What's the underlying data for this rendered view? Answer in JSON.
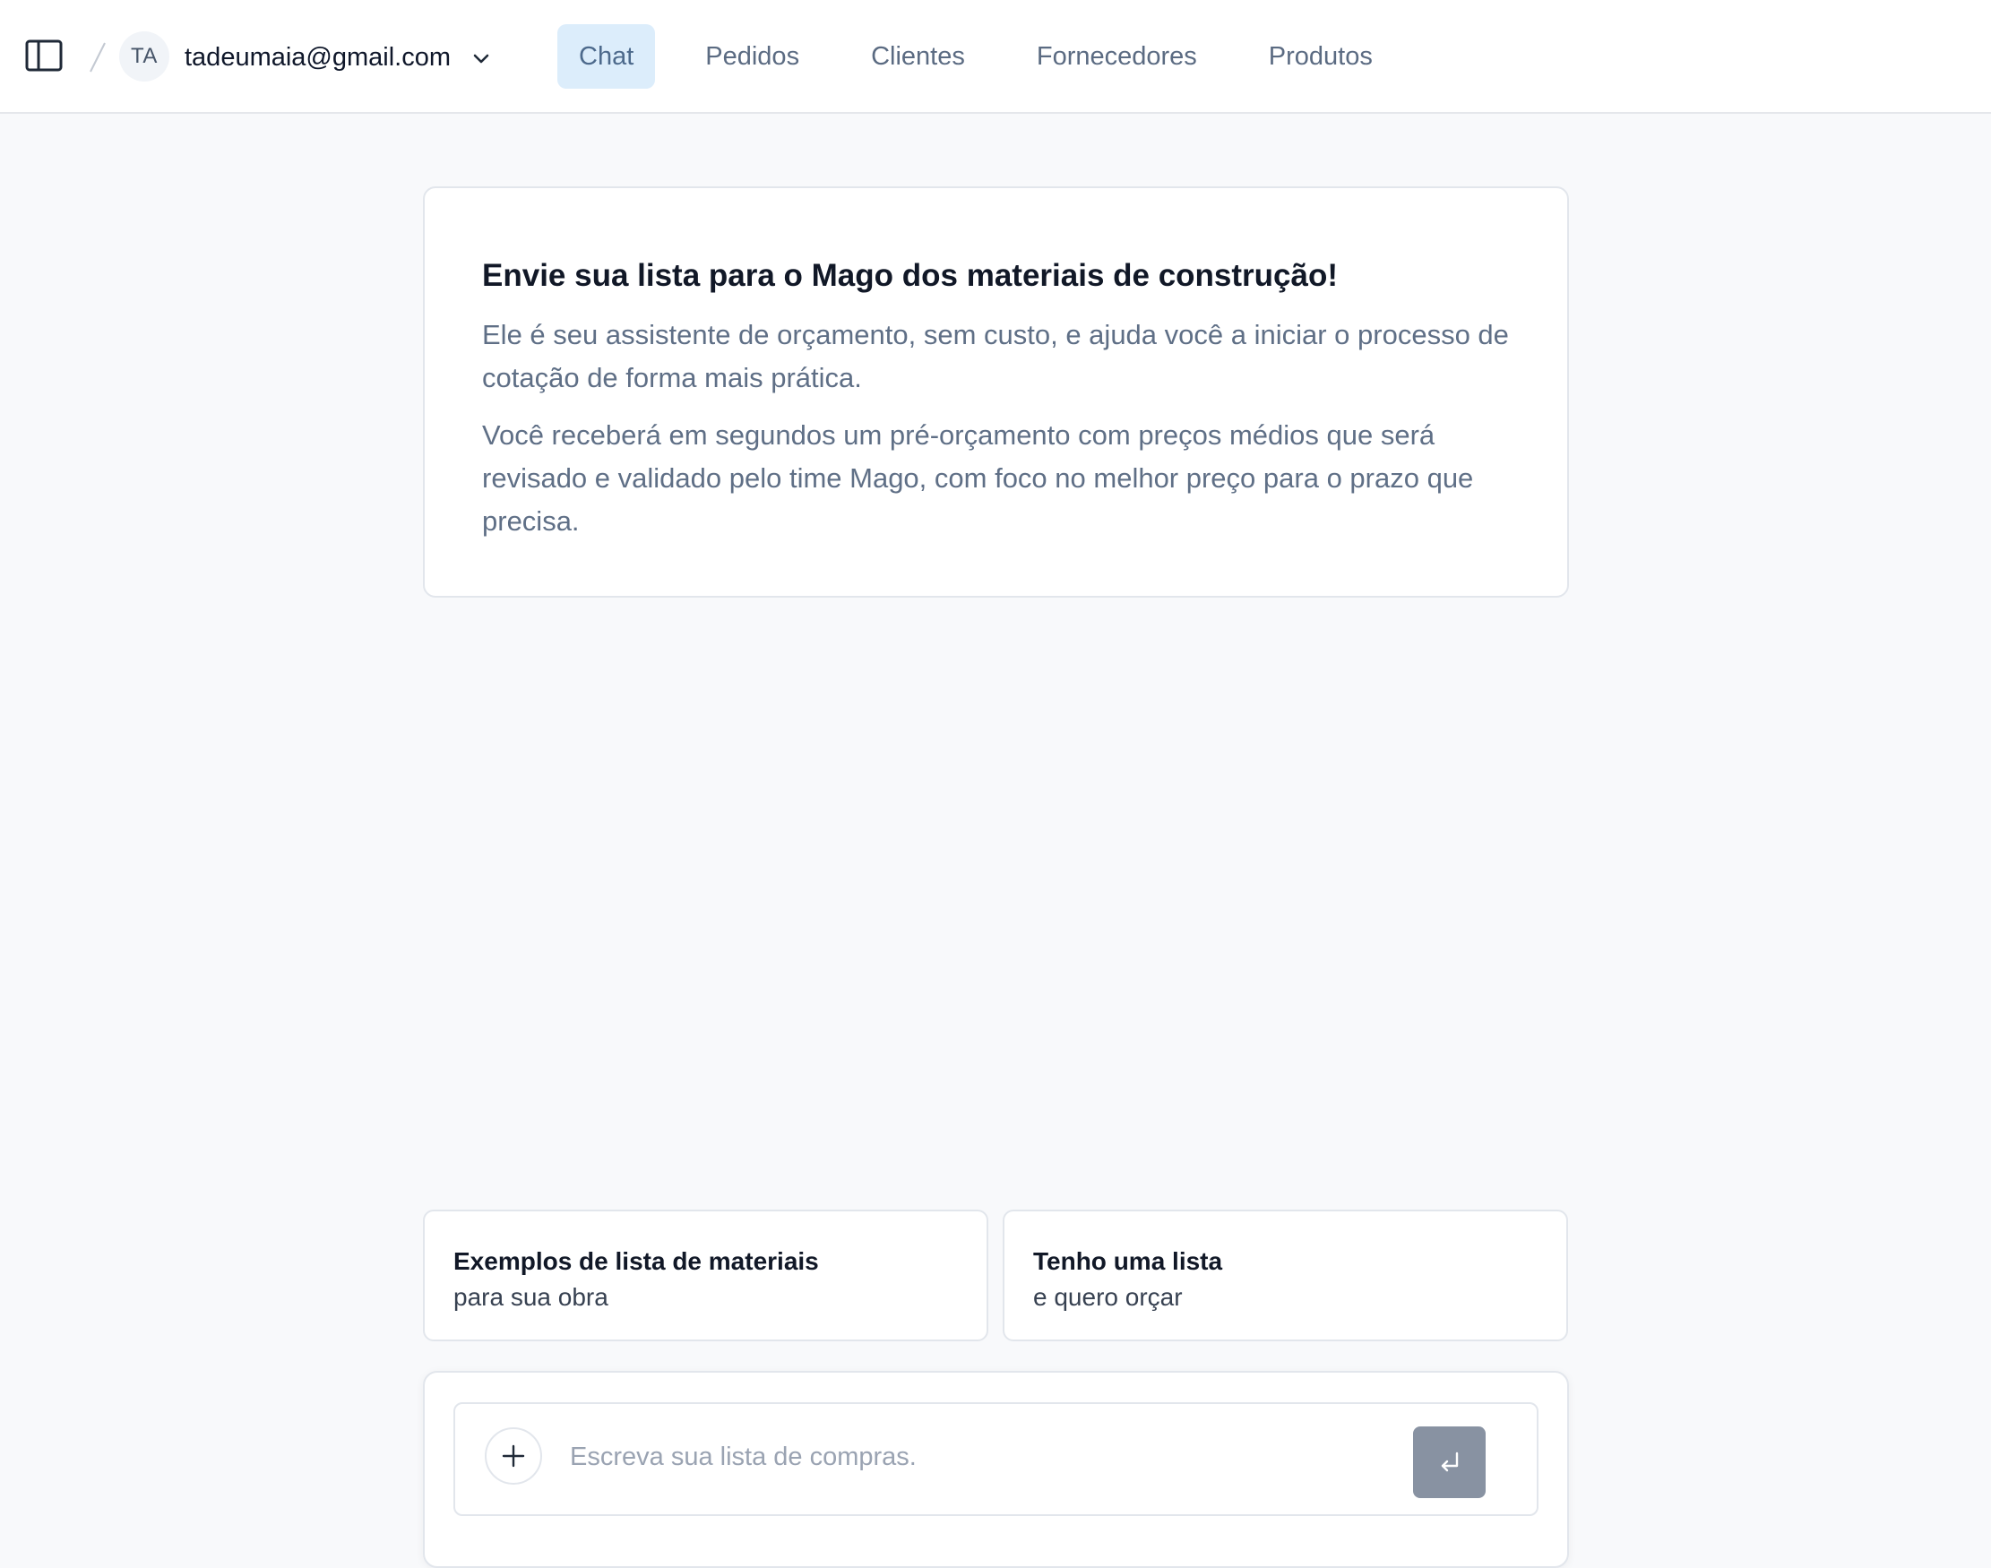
{
  "header": {
    "avatar_initials": "TA",
    "account_email": "tadeumaia@gmail.com",
    "nav": [
      {
        "label": "Chat",
        "active": true
      },
      {
        "label": "Pedidos",
        "active": false
      },
      {
        "label": "Clientes",
        "active": false
      },
      {
        "label": "Fornecedores",
        "active": false
      },
      {
        "label": "Produtos",
        "active": false
      }
    ],
    "icons": {
      "sidebar_toggle": "sidebar-panel-icon",
      "separator": "slash-separator",
      "account_menu": "chevron-down-icon"
    }
  },
  "intro": {
    "title": "Envie sua lista para o Mago dos materiais de construção!",
    "paragraph1": "Ele é seu assistente de orçamento, sem custo, e ajuda você a iniciar o processo de cotação de forma mais prática.",
    "paragraph2": "Você receberá em segundos um pré-orçamento com preços médios que será revisado e validado pelo time Mago, com foco no melhor preço para o prazo que precisa."
  },
  "suggestions": [
    {
      "title": "Exemplos de lista de materiais",
      "subtitle": "para sua obra"
    },
    {
      "title": "Tenho uma lista",
      "subtitle": "e quero orçar"
    }
  ],
  "composer": {
    "placeholder": "Escreva sua lista de compras.",
    "value": "",
    "attach_icon": "plus-icon",
    "send_icon": "enter-return-icon"
  },
  "colors": {
    "accent_bg": "#dcedfb",
    "send_button": "#8892a2",
    "page_bg": "#f8f9fb"
  }
}
